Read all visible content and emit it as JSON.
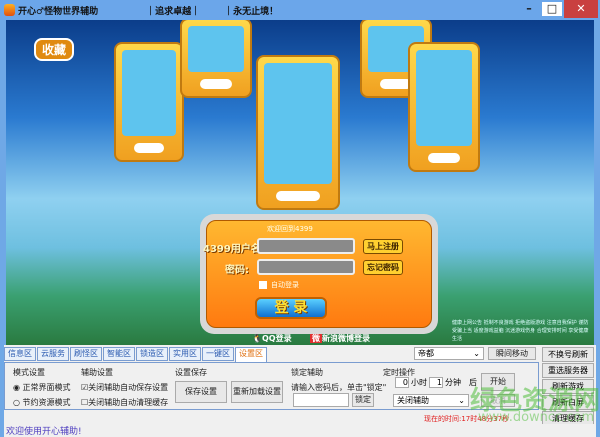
{
  "window": {
    "title": "开心♂怪物世界辅助",
    "slogan1": "｜追求卓越｜",
    "slogan2": "｜永无止境！",
    "minimize": "–",
    "maximize": "□",
    "close": "✕"
  },
  "game": {
    "favorite": "收藏",
    "welcome": "欢迎回到4399",
    "username_label": "4399用户名:",
    "password_label": "密码:",
    "register": "马上注册",
    "forgot": "忘记密码",
    "auto_login": "自动登录",
    "login": "登 录",
    "qq_login": "QQ登录",
    "weibo_login": "新浪微博登录",
    "notice": "健康上网公告 抵制不良游戏 拒绝盗版游戏 注意自我保护 谨防受骗上当 适度游戏益脑 沉迷游戏伤身 合理安排时间 享受健康生活"
  },
  "tabs": [
    "信息区",
    "云服务",
    "刷怪区",
    "智能区",
    "锁造区",
    "实用区",
    "一键区",
    "设置区"
  ],
  "mode": {
    "title": "模式设置",
    "normal": "正常界面模式",
    "save": "节约资源模式"
  },
  "assist": {
    "title": "辅助设置",
    "opt1": "关闭辅助自动保存设置",
    "opt2": "关闭辅助自动清理缓存"
  },
  "save": {
    "title": "设置保存",
    "save_btn": "保存设置",
    "reload_btn": "重新加载设置"
  },
  "lock": {
    "title": "锁定辅助",
    "hint": "请输入密码后，单击\"锁定\"",
    "btn": "锁定"
  },
  "timer": {
    "title": "定时操作",
    "hours": "0",
    "hour_unit": "小时",
    "minutes": "1",
    "minute_unit": "分钟",
    "after": "后",
    "start": "开始",
    "cancel": "取消",
    "action": "关闭辅助"
  },
  "server": {
    "select": "帝都",
    "move": "瞬间移动"
  },
  "right_buttons": [
    "不换号刷新",
    "重选服务器",
    "刷新游戏",
    "刷新白屏",
    "清理缓存"
  ],
  "clock": "现在的时间:17时48分37秒",
  "status": "欢迎使用开心辅助!",
  "watermark": {
    "name": "绿色资源网",
    "url": "www.downcc.com"
  }
}
